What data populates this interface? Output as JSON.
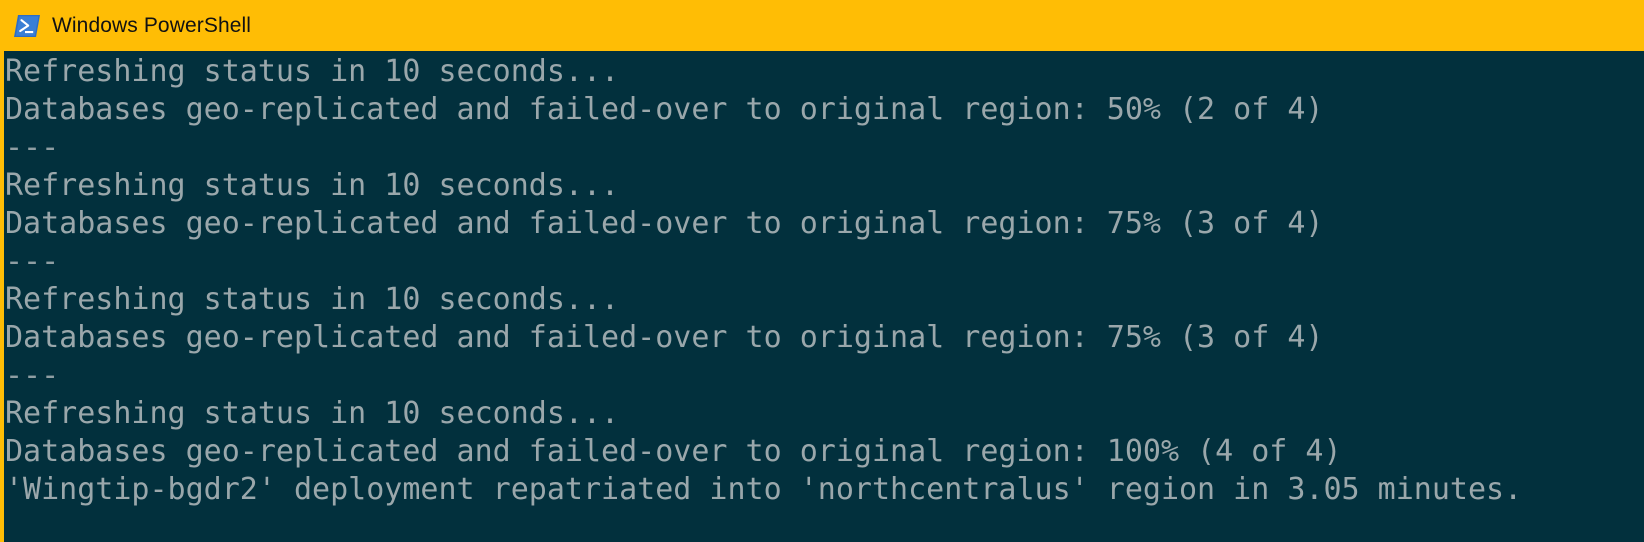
{
  "window": {
    "titlebar": {
      "title": "Windows PowerShell",
      "icon": "powershell-icon",
      "background_color": "#ffbd05",
      "text_color": "#121212"
    },
    "console": {
      "background_color": "#02303d",
      "text_color": "#9aa7ab",
      "accent_border_color": "#ffbd05",
      "lines": [
        "Refreshing status in 10 seconds...",
        "Databases geo-replicated and failed-over to original region: 50% (2 of 4)",
        "---",
        "Refreshing status in 10 seconds...",
        "Databases geo-replicated and failed-over to original region: 75% (3 of 4)",
        "---",
        "Refreshing status in 10 seconds...",
        "Databases geo-replicated and failed-over to original region: 75% (3 of 4)",
        "---",
        "Refreshing status in 10 seconds...",
        "Databases geo-replicated and failed-over to original region: 100% (4 of 4)",
        "'Wingtip-bgdr2' deployment repatriated into 'northcentralus' region in 3.05 minutes."
      ]
    }
  }
}
